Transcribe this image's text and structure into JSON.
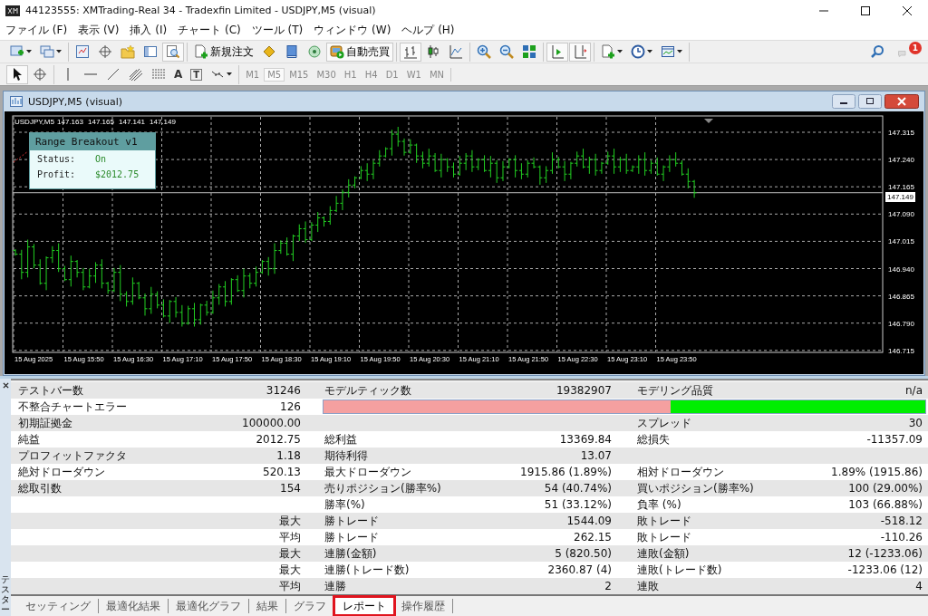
{
  "window": {
    "title": "44123555: XMTrading-Real 34 - Tradexfin Limited - USDJPY,M5 (visual)"
  },
  "menu": [
    "ファイル (F)",
    "表示 (V)",
    "挿入 (I)",
    "チャート (C)",
    "ツール (T)",
    "ウィンドウ (W)",
    "ヘルプ (H)"
  ],
  "toolbar": [
    [
      {
        "kind": "new_chart",
        "pressed": false,
        "dropdown": true
      },
      {
        "kind": "profiles",
        "pressed": false,
        "dropdown": true
      }
    ],
    [
      {
        "kind": "market_watch",
        "pressed": false,
        "dropdown": false
      },
      {
        "kind": "data_window",
        "pressed": false,
        "dropdown": false
      },
      {
        "kind": "navigator",
        "pressed": false,
        "dropdown": false
      },
      {
        "kind": "terminal",
        "pressed": false,
        "dropdown": false
      },
      {
        "kind": "tester",
        "pressed": true,
        "dropdown": false
      }
    ],
    [
      {
        "kind": "new_order",
        "label": "新規注文",
        "pressed": false,
        "dropdown": false
      },
      {
        "kind": "editor",
        "pressed": false,
        "dropdown": false
      },
      {
        "kind": "library",
        "pressed": false,
        "dropdown": false
      },
      {
        "kind": "signals",
        "pressed": false,
        "dropdown": false
      },
      {
        "kind": "auto_trading",
        "label": "自動売買",
        "pressed": true,
        "dropdown": false
      }
    ],
    [
      {
        "kind": "bar_chart",
        "pressed": true,
        "dropdown": false
      },
      {
        "kind": "candles",
        "pressed": false,
        "dropdown": false
      },
      {
        "kind": "line_chart",
        "pressed": false,
        "dropdown": false
      }
    ],
    [
      {
        "kind": "zoom_in",
        "pressed": false,
        "dropdown": false
      },
      {
        "kind": "zoom_out",
        "pressed": false,
        "dropdown": false
      },
      {
        "kind": "tile",
        "pressed": false,
        "dropdown": false
      }
    ],
    [
      {
        "kind": "auto_scroll",
        "pressed": true,
        "dropdown": false
      },
      {
        "kind": "chart_shift",
        "pressed": true,
        "dropdown": false
      }
    ],
    [
      {
        "kind": "indicators",
        "pressed": false,
        "dropdown": true
      },
      {
        "kind": "periods",
        "pressed": false,
        "dropdown": true
      },
      {
        "kind": "templates",
        "pressed": false,
        "dropdown": true
      }
    ]
  ],
  "notifications": {
    "badge": "1"
  },
  "drawing_toolbar": [
    [
      {
        "kind": "cursor",
        "pressed": true,
        "dropdown": false
      },
      {
        "kind": "crosshair",
        "pressed": false,
        "dropdown": false
      }
    ],
    [
      {
        "kind": "vertical_line",
        "pressed": false,
        "dropdown": false
      },
      {
        "kind": "horizontal_line",
        "pressed": false,
        "dropdown": false
      },
      {
        "kind": "trend_line",
        "pressed": false,
        "dropdown": false
      },
      {
        "kind": "fibo_channel",
        "pressed": false,
        "dropdown": false
      },
      {
        "kind": "fibo_levels",
        "pressed": false,
        "dropdown": false
      },
      {
        "kind": "text",
        "glyph": "A",
        "pressed": false,
        "dropdown": false
      },
      {
        "kind": "label",
        "glyph": "T",
        "pressed": false,
        "dropdown": false
      },
      {
        "kind": "arrows",
        "pressed": false,
        "dropdown": true
      }
    ]
  ],
  "timeframes": [
    {
      "label": "M1",
      "selected": false,
      "disabled": true
    },
    {
      "label": "M5",
      "selected": true,
      "disabled": true
    },
    {
      "label": "M15",
      "selected": false,
      "disabled": true
    },
    {
      "label": "M30",
      "selected": false,
      "disabled": true
    },
    {
      "label": "H1",
      "selected": false,
      "disabled": true
    },
    {
      "label": "H4",
      "selected": false,
      "disabled": true
    },
    {
      "label": "D1",
      "selected": false,
      "disabled": true
    },
    {
      "label": "W1",
      "selected": false,
      "disabled": true
    },
    {
      "label": "MN",
      "selected": false,
      "disabled": true
    }
  ],
  "chart": {
    "title": "USDJPY,M5 (visual)",
    "symbol": "USDJPY,M5",
    "ohlc": [
      "147.163",
      "147.165",
      "147.141",
      "147.149"
    ],
    "current_price": "147.149",
    "panel": {
      "title": "Range Breakout v1",
      "rows": [
        {
          "label": "Status:",
          "value": "On"
        },
        {
          "label": "Profit:",
          "value": "$2012.75"
        }
      ]
    },
    "price_axis": [
      "147.315",
      "147.240",
      "147.165",
      "147.090",
      "147.015",
      "146.940",
      "146.865",
      "146.790",
      "146.715"
    ],
    "time_axis": [
      "15 Aug 2025",
      "15 Aug 15:50",
      "15 Aug 16:30",
      "15 Aug 17:10",
      "15 Aug 17:50",
      "15 Aug 18:30",
      "15 Aug 19:10",
      "15 Aug 19:50",
      "15 Aug 20:30",
      "15 Aug 21:10",
      "15 Aug 21:50",
      "15 Aug 22:30",
      "15 Aug 23:10",
      "15 Aug 23:50"
    ]
  },
  "report": {
    "rows": [
      {
        "kind": "text",
        "label": "テストバー数",
        "value": "31246",
        "label2": "モデルティック数",
        "value2": "19382907",
        "label3": "モデリング品質",
        "value3": "n/a"
      },
      {
        "kind": "quality",
        "label": "不整合チャートエラー",
        "value": "126",
        "level": 0.577
      },
      {
        "kind": "text",
        "label": "初期証拠金",
        "value": "100000.00",
        "label3": "スプレッド",
        "value3": "30"
      },
      {
        "kind": "text",
        "label": "純益",
        "value": "2012.75",
        "label2": "総利益",
        "value2": "13369.84",
        "label3": "総損失",
        "value3": "-11357.09"
      },
      {
        "kind": "text",
        "label": "プロフィットファクタ",
        "value": "1.18",
        "label2": "期待利得",
        "value2": "13.07"
      },
      {
        "kind": "text",
        "label": "絶対ドローダウン",
        "value": "520.13",
        "label2": "最大ドローダウン",
        "value2": "1915.86 (1.89%)",
        "label3": "相対ドローダウン",
        "value3": "1.89% (1915.86)"
      },
      {
        "kind": "text",
        "label": "総取引数",
        "value": "154",
        "label2": "売りポジション(勝率%)",
        "value2": "54 (40.74%)",
        "label3": "買いポジション(勝率%)",
        "value3": "100 (29.00%)"
      },
      {
        "kind": "text",
        "label2": "勝率(%)",
        "value2": "51 (33.12%)",
        "label3": "負率 (%)",
        "value3": "103 (66.88%)"
      },
      {
        "kind": "text",
        "value": "最大",
        "label2": "勝トレード",
        "value2": "1544.09",
        "label3": "敗トレード",
        "value3": "-518.12"
      },
      {
        "kind": "text",
        "value": "平均",
        "label2": "勝トレード",
        "value2": "262.15",
        "label3": "敗トレード",
        "value3": "-110.26"
      },
      {
        "kind": "text",
        "value": "最大",
        "label2": "連勝(金額)",
        "value2": "5 (820.50)",
        "label3": "連敗(金額)",
        "value3": "12 (-1233.06)"
      },
      {
        "kind": "text",
        "value": "最大",
        "label2": "連勝(トレード数)",
        "value2": "2360.87 (4)",
        "label3": "連敗(トレード数)",
        "value3": "-1233.06 (12)"
      },
      {
        "kind": "text",
        "value": "平均",
        "label2": "連勝",
        "value2": "2",
        "label3": "連敗",
        "value3": "4"
      }
    ]
  },
  "panel_side": {
    "title": "テスター"
  },
  "tabs": [
    {
      "label": "セッティング",
      "selected": false,
      "highlighted": false
    },
    {
      "label": "最適化結果",
      "selected": false,
      "highlighted": false
    },
    {
      "label": "最適化グラフ",
      "selected": false,
      "highlighted": false
    },
    {
      "label": "結果",
      "selected": false,
      "highlighted": false
    },
    {
      "label": "グラフ",
      "selected": false,
      "highlighted": false
    },
    {
      "label": "レポート",
      "selected": true,
      "highlighted": true
    },
    {
      "label": "操作履歴",
      "selected": false,
      "highlighted": false
    }
  ]
}
